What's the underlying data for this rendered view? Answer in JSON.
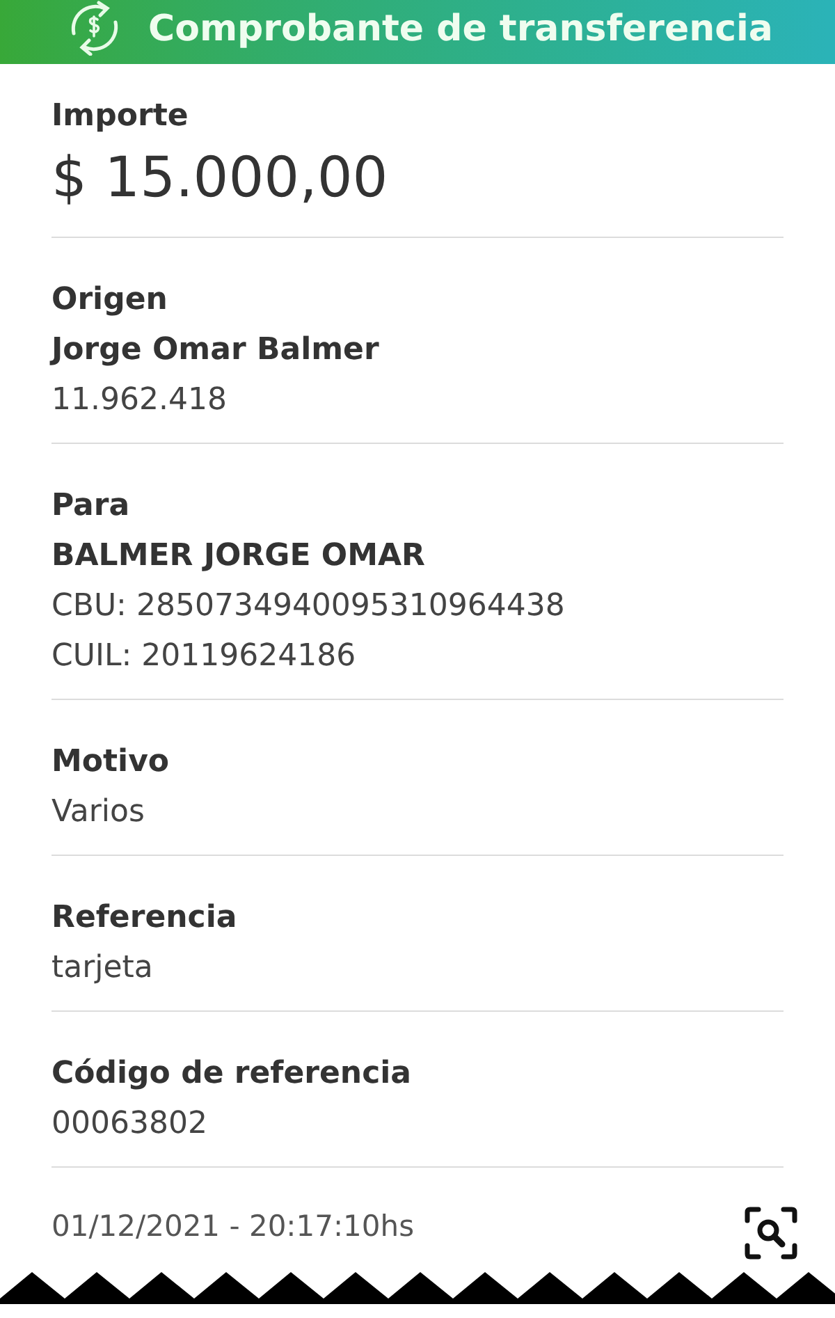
{
  "header": {
    "title": "Comprobante de transferencia"
  },
  "amount": {
    "label": "Importe",
    "value": "$ 15.000,00"
  },
  "sections": [
    {
      "label": "Origen",
      "lines": [
        {
          "text": "Jorge Omar Balmer",
          "bold": true
        },
        {
          "text": "11.962.418",
          "bold": false
        }
      ]
    },
    {
      "label": "Para",
      "lines": [
        {
          "text": "BALMER JORGE OMAR",
          "bold": true
        },
        {
          "text": "CBU: 2850734940095310964438",
          "bold": false
        },
        {
          "text": "CUIL: 20119624186",
          "bold": false
        }
      ]
    },
    {
      "label": "Motivo",
      "lines": [
        {
          "text": "Varios",
          "bold": false
        }
      ]
    },
    {
      "label": "Referencia",
      "lines": [
        {
          "text": "tarjeta",
          "bold": false
        }
      ]
    },
    {
      "label": "Código de referencia",
      "lines": [
        {
          "text": "00063802",
          "bold": false
        }
      ]
    }
  ],
  "footer": {
    "datetime": "01/12/2021 - 20:17:10hs"
  }
}
